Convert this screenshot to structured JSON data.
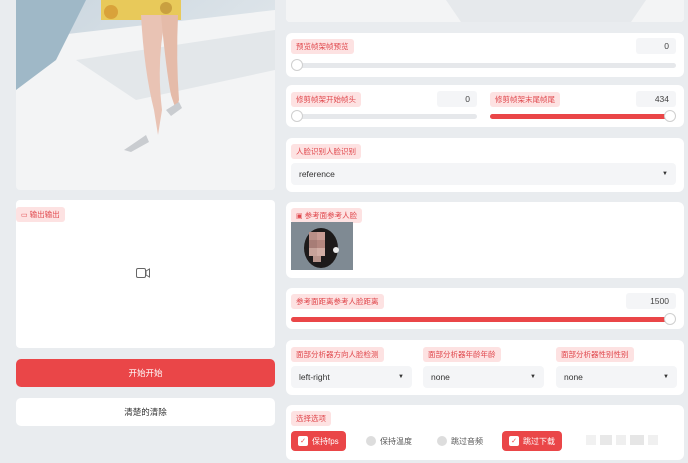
{
  "colors": {
    "accent": "#ea4648",
    "badge_bg": "#fde2e2",
    "badge_text": "#e0474c",
    "page_bg": "#e9ecef"
  },
  "trim_preview": {
    "label": "预览帧架帧预览",
    "value": "0",
    "slider_fraction": 0
  },
  "trim_start": {
    "label": "修剪帧架开始帧头",
    "value": "0",
    "slider_fraction": 0
  },
  "trim_end": {
    "label": "修剪帧架末尾帧尾",
    "value": "434",
    "slider_fraction": 1
  },
  "face_recognition": {
    "label": "人脸识别人脸识别",
    "value": "reference",
    "icon": "chevron-down-icon"
  },
  "reference_face": {
    "label": "参考面参考人脸",
    "icon": "image-icon"
  },
  "reference_distance": {
    "label": "参考面距离参考人脸距离",
    "value": "1500",
    "slider_fraction": 1
  },
  "output": {
    "label": "输出输出",
    "icon": "video-icon"
  },
  "actions": {
    "start": "开始开始",
    "clear": "清楚的清除"
  },
  "analyser": {
    "direction": {
      "label": "面部分析器方向人脸检测",
      "value": "left-right"
    },
    "age": {
      "label": "面部分析器年龄年龄",
      "value": "none"
    },
    "gender": {
      "label": "面部分析器性别性别",
      "value": "none"
    }
  },
  "options": {
    "label": "选择选项",
    "items": [
      {
        "label": "保持fps",
        "checked": true
      },
      {
        "label": "保持温度",
        "checked": false
      },
      {
        "label": "跳过音频",
        "checked": false
      },
      {
        "label": "跳过下载",
        "checked": true
      }
    ]
  }
}
